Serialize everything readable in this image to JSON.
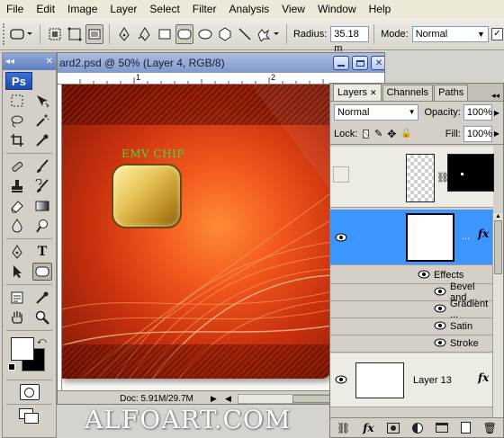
{
  "menubar": {
    "items": [
      "File",
      "Edit",
      "Image",
      "Layer",
      "Select",
      "Filter",
      "Analysis",
      "View",
      "Window",
      "Help"
    ]
  },
  "options": {
    "radius_label": "Radius:",
    "radius_value": "35.18 m",
    "mode_label": "Mode:",
    "mode_value": "Normal"
  },
  "tools": {
    "logo": "Ps",
    "collapse_glyph": "◂◂"
  },
  "document": {
    "title": "ard2.psd @ 50% (Layer 4, RGB/8)",
    "ruler_marks": [
      "1",
      "2"
    ],
    "status": "Doc: 5.91M/29.7M",
    "card_label": "EMV CHIP"
  },
  "watermark": "ALFOART.COM",
  "layers_panel": {
    "tabs": [
      "Layers",
      "Channels",
      "Paths"
    ],
    "blend_mode": "Normal",
    "opacity_label": "Opacity:",
    "opacity_value": "100%",
    "lock_label": "Lock:",
    "fill_label": "Fill:",
    "fill_value": "100%",
    "selected_layer_name": "...",
    "effects_label": "Effects",
    "effects": [
      "Bevel and ...",
      "Gradient ...",
      "Satin",
      "Stroke"
    ],
    "bottom_layer_name": "Layer 13",
    "fx_glyph": "fx"
  },
  "colors": {
    "selected_layer": "#3d95ff",
    "title_bar": "#7f99cc",
    "emv_text": "#47d847"
  }
}
